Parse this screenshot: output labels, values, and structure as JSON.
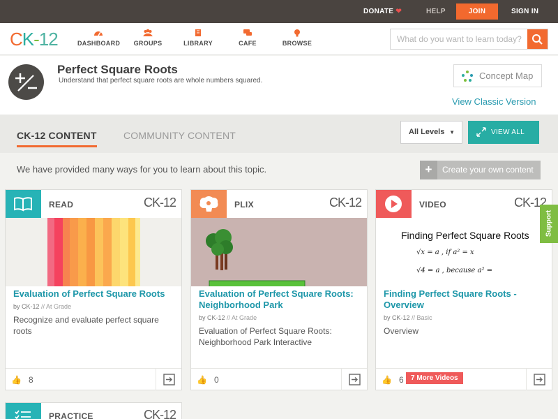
{
  "topbar": {
    "donate": "DONATE",
    "help": "HELP",
    "join": "JOIN",
    "signin": "SIGN IN"
  },
  "nav": {
    "logo": {
      "c": "C",
      "k": "K",
      "dash": "-",
      "num": "12"
    },
    "items": [
      {
        "label": "DASHBOARD",
        "icon": "gauge-icon"
      },
      {
        "label": "GROUPS",
        "icon": "groups-icon"
      },
      {
        "label": "LIBRARY",
        "icon": "library-icon"
      },
      {
        "label": "CAFE",
        "icon": "chat-icon"
      },
      {
        "label": "BROWSE",
        "icon": "lightbulb-icon"
      }
    ],
    "search_placeholder": "What do you want to learn today?"
  },
  "hero": {
    "title": "Perfect Square Roots",
    "subtitle": "Understand that perfect square roots are whole numbers squared.",
    "concept_map": "Concept Map",
    "classic": "View Classic Version"
  },
  "tabs": {
    "ck12": "CK-12 CONTENT",
    "community": "COMMUNITY CONTENT",
    "levels": "All Levels",
    "view_all": "VIEW ALL"
  },
  "intro": "We have provided many ways for you to learn about this topic.",
  "create": "Create your own content",
  "cards": [
    {
      "type": "READ",
      "brand": "CK-12",
      "title": "Evaluation of Perfect Square Roots",
      "by": "by CK-12",
      "level": "// At Grade",
      "desc": "Recognize and evaluate perfect square roots",
      "likes": "8"
    },
    {
      "type": "PLIX",
      "brand": "CK-12",
      "title": "Evaluation of Perfect Square Roots: Neighborhood Park",
      "by": "by CK-12",
      "level": "// At Grade",
      "desc": "Evaluation of Perfect Square Roots: Neighborhood Park Interactive",
      "likes": "0"
    },
    {
      "type": "VIDEO",
      "brand": "CK-12",
      "title": "Finding Perfect Square Roots - Overview",
      "by": "by CK-12",
      "level": "// Basic",
      "desc": "Overview",
      "likes": "6",
      "more": "7 More Videos",
      "thumb_title": "Finding Perfect Square Roots",
      "thumb_line1": "√x = a ,  if  a² = x",
      "thumb_line2": "√4 = a ,  because  a² ="
    },
    {
      "type": "PRACTICE",
      "brand": "CK-12"
    }
  ],
  "support": "Support",
  "colors": {
    "accent": "#f26a30",
    "teal": "#27ada4",
    "link": "#1e97a9",
    "read_badge": "#27b3b6",
    "plix_badge": "#f28b54",
    "video_badge": "#ef5a5a"
  }
}
